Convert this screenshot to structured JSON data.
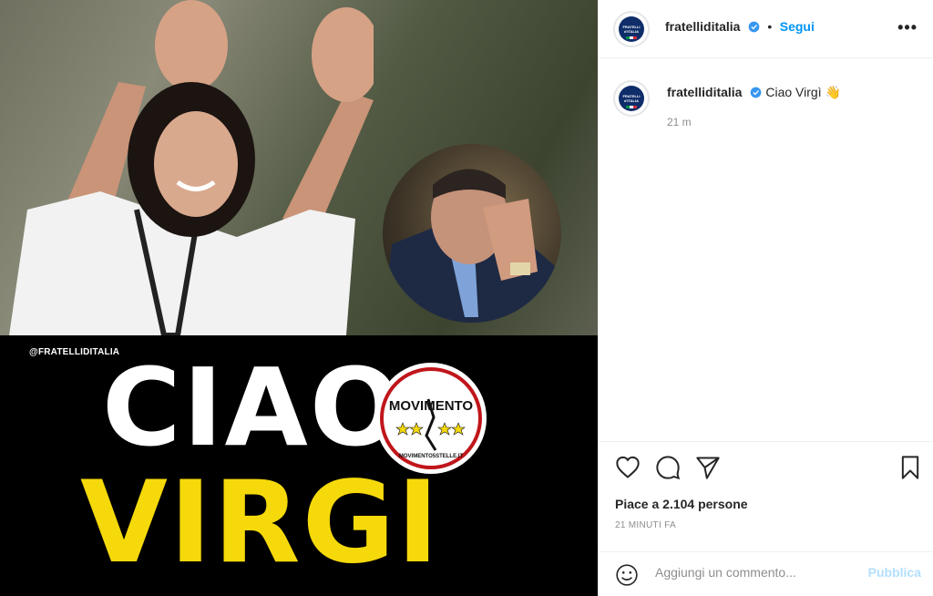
{
  "image": {
    "watermark": "@FRATELLIDITALIA",
    "headline_line1": "CIAO",
    "headline_line2": "VIRGÌ",
    "logo_text": "MOVIMENTO",
    "logo_subtext": "MOVIMENTO5STELLE.IT",
    "headline_color_primary": "#ffffff",
    "headline_color_secondary": "#f5d90a"
  },
  "header": {
    "avatar_icon": "fratelli-ditalia-logo",
    "username": "fratelliditalia",
    "verified_icon": "verified-badge",
    "separator": "•",
    "follow_label": "Segui",
    "more_icon": "more-horizontal",
    "more_label": "•••"
  },
  "caption": {
    "username": "fratelliditalia",
    "text": "Ciao Virgì 👋",
    "time": "21 m"
  },
  "actions": {
    "like_icon": "heart-outline",
    "comment_icon": "comment-bubble",
    "share_icon": "paper-plane",
    "save_icon": "bookmark-outline",
    "likes_text": "Piace a 2.104 persone",
    "posted_ago": "21 MINUTI FA"
  },
  "comment_box": {
    "emoji_icon": "smiley-face",
    "placeholder": "Aggiungi un commento...",
    "publish_label": "Pubblica"
  },
  "colors": {
    "link_blue": "#0095f6",
    "publish_disabled": "#b2dffc",
    "verified_blue": "#3897f0"
  }
}
